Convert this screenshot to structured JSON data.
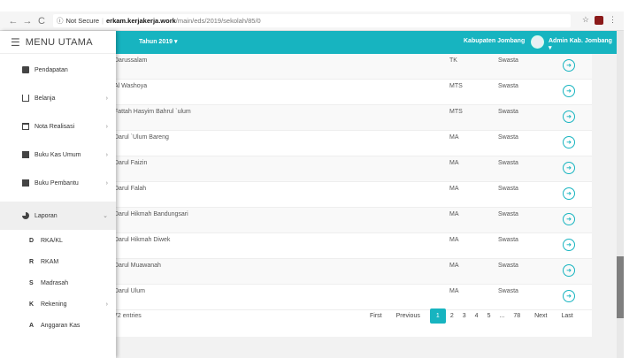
{
  "browser": {
    "security": "Not Secure",
    "host": "erkam.kerjakerja.work",
    "path": "/main/eds/2019/sekolah/85/0"
  },
  "header": {
    "year": "Tahun 2019 ▾",
    "region": "Kabupaten Jombang",
    "user": "Admin Kab. Jombang ▾"
  },
  "sidebar": {
    "title": "MENU UTAMA",
    "items": [
      {
        "label": "Pendapatan",
        "icon": "document-icon"
      },
      {
        "label": "Belanja",
        "icon": "cart-icon"
      },
      {
        "label": "Nota Realisasi",
        "icon": "calendar-icon"
      },
      {
        "label": "Buku Kas Umum",
        "icon": "book-icon"
      },
      {
        "label": "Buku Pembantu",
        "icon": "book-icon"
      },
      {
        "label": "Laporan",
        "icon": "pie-chart-icon"
      }
    ],
    "subitems": [
      {
        "letter": "D",
        "label": "RKA/KL"
      },
      {
        "letter": "R",
        "label": "RKAM"
      },
      {
        "letter": "S",
        "label": "Madrasah"
      },
      {
        "letter": "K",
        "label": "Rekening"
      },
      {
        "letter": "A",
        "label": "Anggaran Kas"
      }
    ]
  },
  "table": {
    "rows": [
      {
        "name": "Darussalam",
        "jenjang": "TK",
        "status": "Swasta"
      },
      {
        "name": "Al Washoya",
        "jenjang": "MTS",
        "status": "Swasta"
      },
      {
        "name": "Fattah Hasyim Bahrul `ulum",
        "jenjang": "MTS",
        "status": "Swasta"
      },
      {
        "name": "Darul `Ulum Bareng",
        "jenjang": "MA",
        "status": "Swasta"
      },
      {
        "name": "Darul Faizin",
        "jenjang": "MA",
        "status": "Swasta"
      },
      {
        "name": "Darul Falah",
        "jenjang": "MA",
        "status": "Swasta"
      },
      {
        "name": "Darul Hikmah Bandungsari",
        "jenjang": "MA",
        "status": "Swasta"
      },
      {
        "name": "Darul Hikmah Diwek",
        "jenjang": "MA",
        "status": "Swasta"
      },
      {
        "name": "Darul Muawanah",
        "jenjang": "MA",
        "status": "Swasta"
      },
      {
        "name": "Darul Ulum",
        "jenjang": "MA",
        "status": "Swasta"
      }
    ],
    "entries": "72 entries"
  },
  "pagination": {
    "first": "First",
    "previous": "Previous",
    "pages": [
      "1",
      "2",
      "3",
      "4",
      "5",
      "...",
      "78"
    ],
    "active": "1",
    "next": "Next",
    "last": "Last"
  }
}
